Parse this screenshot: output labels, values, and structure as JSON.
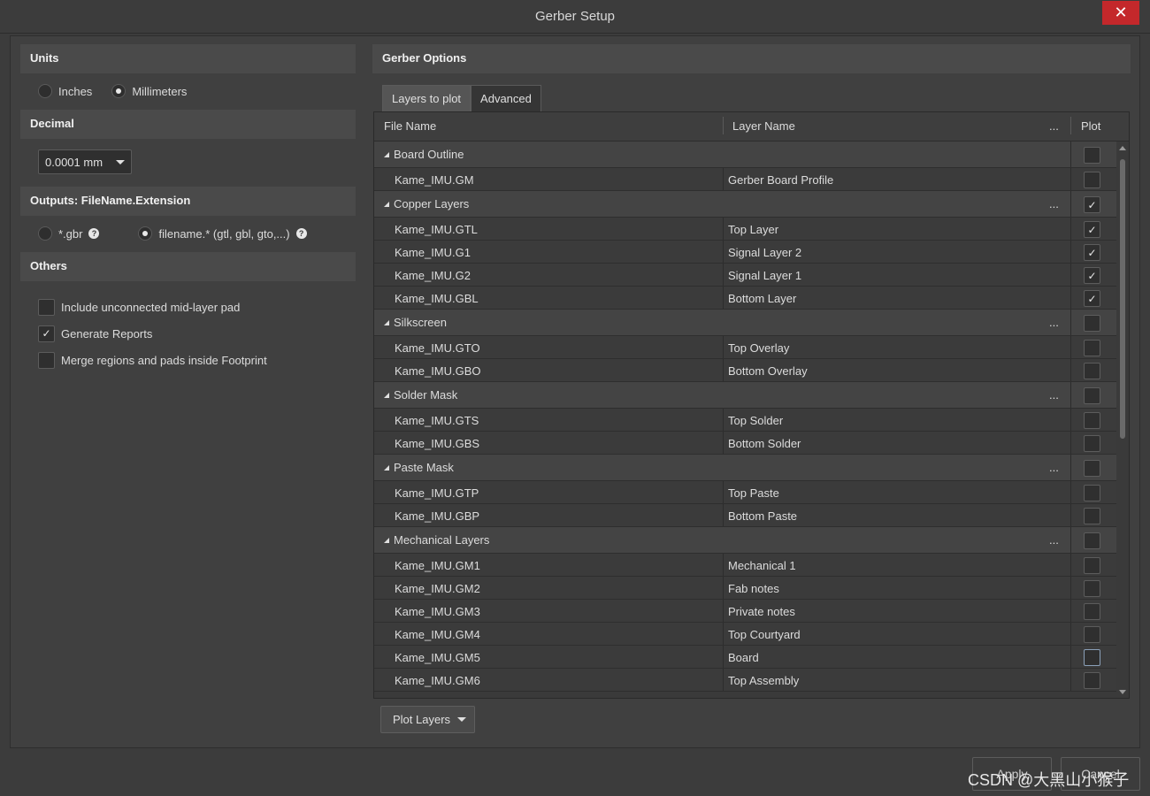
{
  "window": {
    "title": "Gerber Setup",
    "close_glyph": "✕"
  },
  "left": {
    "units": {
      "heading": "Units",
      "options": [
        "Inches",
        "Millimeters"
      ],
      "selected": "Millimeters"
    },
    "decimal": {
      "heading": "Decimal",
      "value": "0.0001 mm"
    },
    "outputs": {
      "heading": "Outputs: FileName.Extension",
      "options": [
        "*.gbr",
        "filename.* (gtl, gbl, gto,...)"
      ],
      "selected": "filename.* (gtl, gbl, gto,...)"
    },
    "others": {
      "heading": "Others",
      "checks": [
        {
          "label": "Include unconnected mid-layer pad",
          "checked": false
        },
        {
          "label": "Generate Reports",
          "checked": true
        },
        {
          "label": "Merge regions and pads inside Footprint",
          "checked": false
        }
      ]
    }
  },
  "right": {
    "heading": "Gerber Options",
    "tabs": [
      "Layers to plot",
      "Advanced"
    ],
    "active_tab": "Layers to plot",
    "columns": {
      "file": "File Name",
      "layer": "Layer Name",
      "dots": "...",
      "plot": "Plot"
    },
    "check_glyph": "✓",
    "groups": [
      {
        "name": "Board Outline",
        "checked": false,
        "dots": "",
        "rows": [
          {
            "file": "Kame_IMU.GM",
            "layer": "Gerber Board Profile",
            "checked": false
          }
        ]
      },
      {
        "name": "Copper Layers",
        "checked": true,
        "dots": "...",
        "rows": [
          {
            "file": "Kame_IMU.GTL",
            "layer": "Top Layer",
            "checked": true
          },
          {
            "file": "Kame_IMU.G1",
            "layer": "Signal Layer 2",
            "checked": true
          },
          {
            "file": "Kame_IMU.G2",
            "layer": "Signal Layer 1",
            "checked": true
          },
          {
            "file": "Kame_IMU.GBL",
            "layer": "Bottom Layer",
            "checked": true
          }
        ]
      },
      {
        "name": "Silkscreen",
        "checked": false,
        "dots": "...",
        "rows": [
          {
            "file": "Kame_IMU.GTO",
            "layer": "Top Overlay",
            "checked": false
          },
          {
            "file": "Kame_IMU.GBO",
            "layer": "Bottom Overlay",
            "checked": false
          }
        ]
      },
      {
        "name": "Solder Mask",
        "checked": false,
        "dots": "...",
        "rows": [
          {
            "file": "Kame_IMU.GTS",
            "layer": "Top Solder",
            "checked": false
          },
          {
            "file": "Kame_IMU.GBS",
            "layer": "Bottom Solder",
            "checked": false
          }
        ]
      },
      {
        "name": "Paste Mask",
        "checked": false,
        "dots": "...",
        "rows": [
          {
            "file": "Kame_IMU.GTP",
            "layer": "Top Paste",
            "checked": false
          },
          {
            "file": "Kame_IMU.GBP",
            "layer": "Bottom Paste",
            "checked": false
          }
        ]
      },
      {
        "name": "Mechanical Layers",
        "checked": false,
        "dots": "...",
        "rows": [
          {
            "file": "Kame_IMU.GM1",
            "layer": "Mechanical 1",
            "checked": false
          },
          {
            "file": "Kame_IMU.GM2",
            "layer": "Fab notes",
            "checked": false
          },
          {
            "file": "Kame_IMU.GM3",
            "layer": "Private notes",
            "checked": false
          },
          {
            "file": "Kame_IMU.GM4",
            "layer": "Top Courtyard",
            "checked": false
          },
          {
            "file": "Kame_IMU.GM5",
            "layer": "Board",
            "checked": false,
            "focus": true
          },
          {
            "file": "Kame_IMU.GM6",
            "layer": "Top Assembly",
            "checked": false
          }
        ]
      }
    ],
    "plot_button": "Plot Layers"
  },
  "footer": {
    "apply": "Apply",
    "cancel": "Cancel"
  },
  "watermark": "CSDN @大黑山小猴子"
}
